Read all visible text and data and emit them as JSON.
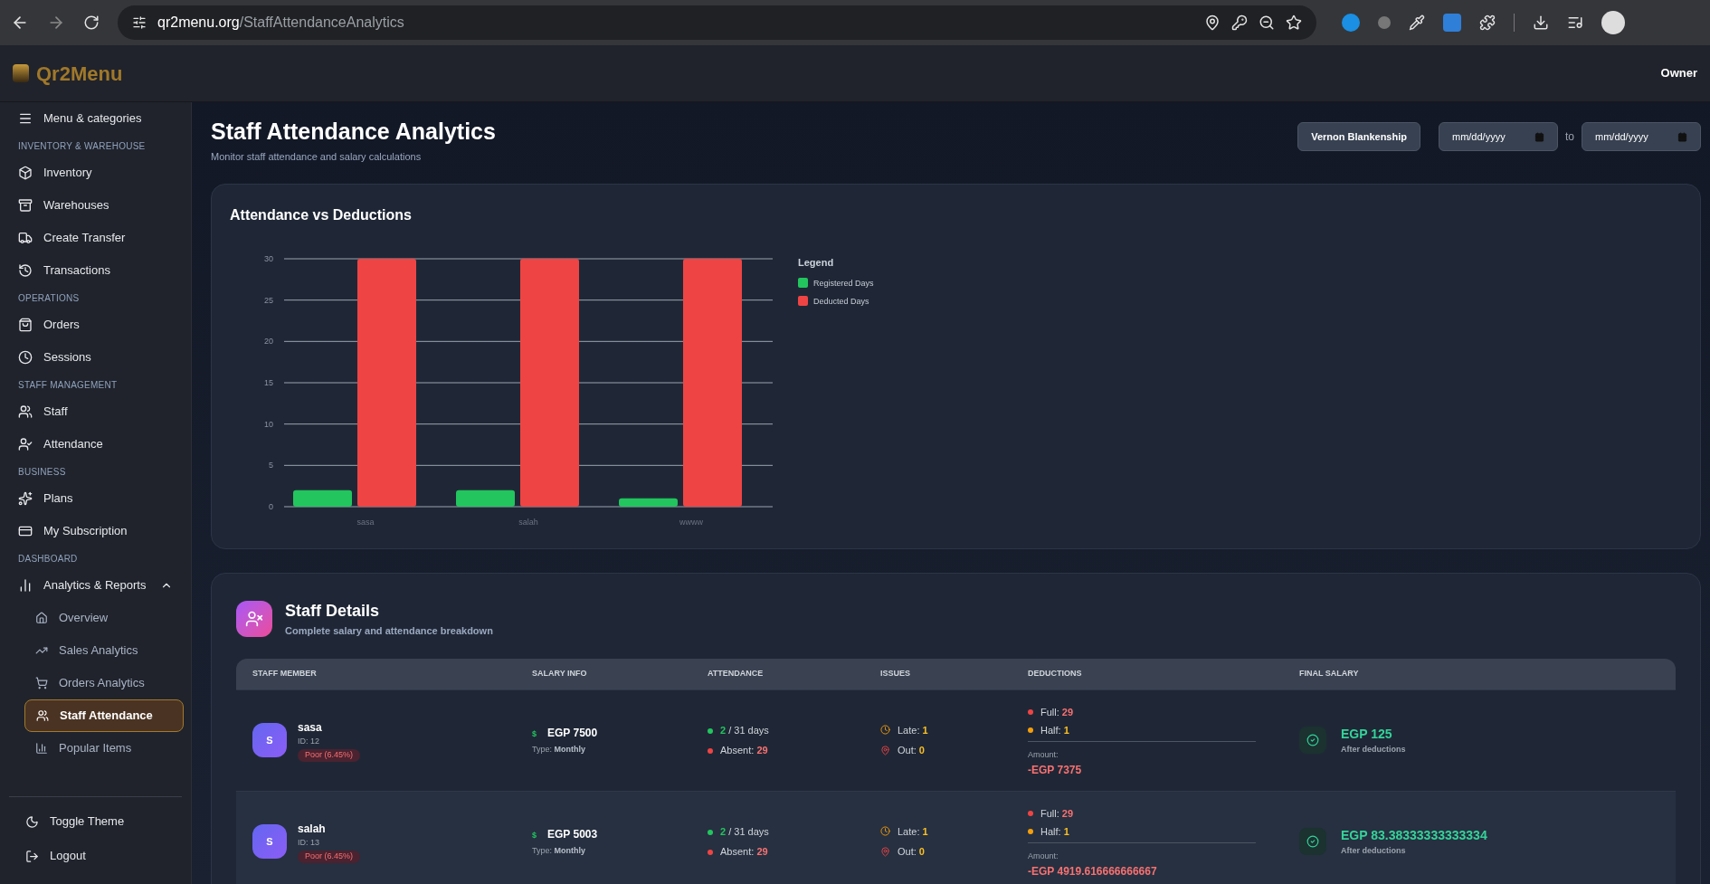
{
  "browser": {
    "url_domain": "qr2menu.org",
    "url_path": "/StaffAttendanceAnalytics"
  },
  "app_header": {
    "brand": "Qr2Menu",
    "user": "Owner"
  },
  "sidebar": {
    "sections": [
      {
        "items": [
          {
            "label": "Menu & categories",
            "selected": false
          }
        ]
      },
      {
        "title": "INVENTORY & WAREHOUSE",
        "items": [
          {
            "label": "Inventory",
            "selected": false
          },
          {
            "label": "Warehouses",
            "selected": false
          },
          {
            "label": "Create Transfer",
            "selected": false
          },
          {
            "label": "Transactions",
            "selected": false
          }
        ]
      },
      {
        "title": "OPERATIONS",
        "items": [
          {
            "label": "Orders",
            "selected": false
          },
          {
            "label": "Sessions",
            "selected": false
          }
        ]
      },
      {
        "title": "STAFF MANAGEMENT",
        "items": [
          {
            "label": "Staff",
            "selected": false
          },
          {
            "label": "Attendance",
            "selected": false
          }
        ]
      },
      {
        "title": "BUSINESS",
        "items": [
          {
            "label": "Plans",
            "selected": false
          },
          {
            "label": "My Subscription",
            "selected": false
          }
        ]
      },
      {
        "title": "DASHBOARD",
        "items": [
          {
            "label": "Analytics & Reports",
            "selected": false,
            "expanded": true,
            "children": [
              {
                "label": "Overview",
                "selected": false
              },
              {
                "label": "Sales Analytics",
                "selected": false
              },
              {
                "label": "Orders Analytics",
                "selected": false
              },
              {
                "label": "Staff Attendance",
                "selected": true
              },
              {
                "label": "Popular Items",
                "selected": false
              }
            ]
          }
        ]
      }
    ],
    "footer": [
      {
        "label": "Toggle Theme"
      },
      {
        "label": "Logout"
      }
    ]
  },
  "page": {
    "title": "Staff Attendance Analytics",
    "subtitle": "Monitor staff attendance and salary calculations",
    "staff_select": {
      "value": "Vernon Blankenship"
    },
    "date_from": {
      "placeholder": "mm/dd/yyyy"
    },
    "range_separator": "to",
    "date_to": {
      "placeholder": "mm/dd/yyyy"
    }
  },
  "chart_card": {
    "title": "Attendance vs Deductions",
    "chart_data": {
      "type": "bar",
      "categories": [
        "sasa",
        "salah",
        "wwww"
      ],
      "series": [
        {
          "name": "Registered Days",
          "color": "#22c55e",
          "values": [
            2,
            2,
            1
          ]
        },
        {
          "name": "Deducted Days",
          "color": "#ef4444",
          "values": [
            30,
            30,
            30
          ]
        }
      ],
      "ylim": [
        0,
        30
      ],
      "yticks": [
        0,
        5,
        10,
        15,
        20,
        25,
        30
      ],
      "grid": true,
      "legend": {
        "title": "Legend"
      }
    }
  },
  "staff_details": {
    "title": "Staff Details",
    "subtitle": "Complete salary and attendance breakdown",
    "columns": [
      "STAFF MEMBER",
      "SALARY INFO",
      "ATTENDANCE",
      "ISSUES",
      "DEDUCTIONS",
      "FINAL SALARY"
    ],
    "rows": [
      {
        "avatar": "S",
        "name": "sasa",
        "id": "ID: 12",
        "badge": "Poor (6.45%)",
        "currency": "$",
        "salary": "EGP 7500",
        "type_label": "Type:",
        "type": "Monthly",
        "present": "2",
        "of_days": "/ 31 days",
        "absent_label": "Absent:",
        "absent": "29",
        "late_label": "Late:",
        "late": "1",
        "out_label": "Out:",
        "out": "0",
        "full_label": "Full:",
        "full": "29",
        "half_label": "Half:",
        "half": "1",
        "amount_label": "Amount:",
        "amount": "-EGP 7375",
        "final": "EGP 125",
        "final_note": "After deductions"
      },
      {
        "avatar": "S",
        "name": "salah",
        "id": "ID: 13",
        "badge": "Poor (6.45%)",
        "currency": "$",
        "salary": "EGP 5003",
        "type_label": "Type:",
        "type": "Monthly",
        "present": "2",
        "of_days": "/ 31 days",
        "absent_label": "Absent:",
        "absent": "29",
        "late_label": "Late:",
        "late": "1",
        "out_label": "Out:",
        "out": "0",
        "full_label": "Full:",
        "full": "29",
        "half_label": "Half:",
        "half": "1",
        "amount_label": "Amount:",
        "amount": "-EGP 4919.616666666667",
        "final": "EGP 83.38333333333334",
        "final_note": "After deductions"
      }
    ]
  }
}
